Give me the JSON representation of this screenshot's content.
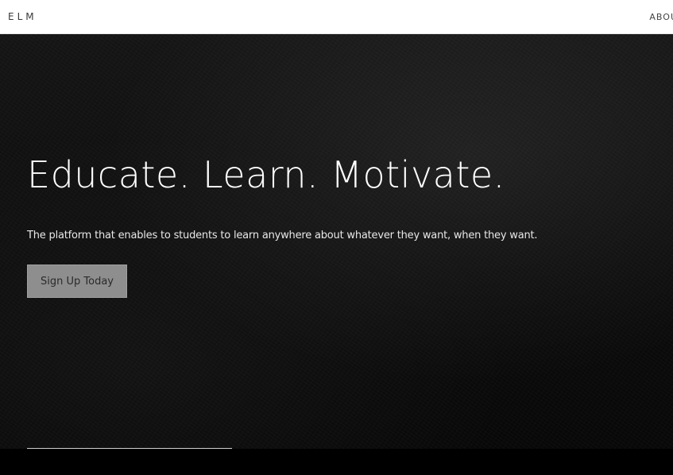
{
  "header": {
    "logo": "ELM",
    "nav_link": "ABOU"
  },
  "hero": {
    "title": "Educate. Learn. Motivate.",
    "subtitle": "The platform that enables to students to learn anywhere about whatever they want, when they want.",
    "cta_label": "Sign Up Today"
  },
  "colors": {
    "navbar_bg": "#ffffff",
    "hero_bg": "#111111",
    "cta_bg": "#8e8e8e",
    "title_text": "#ffffff"
  }
}
